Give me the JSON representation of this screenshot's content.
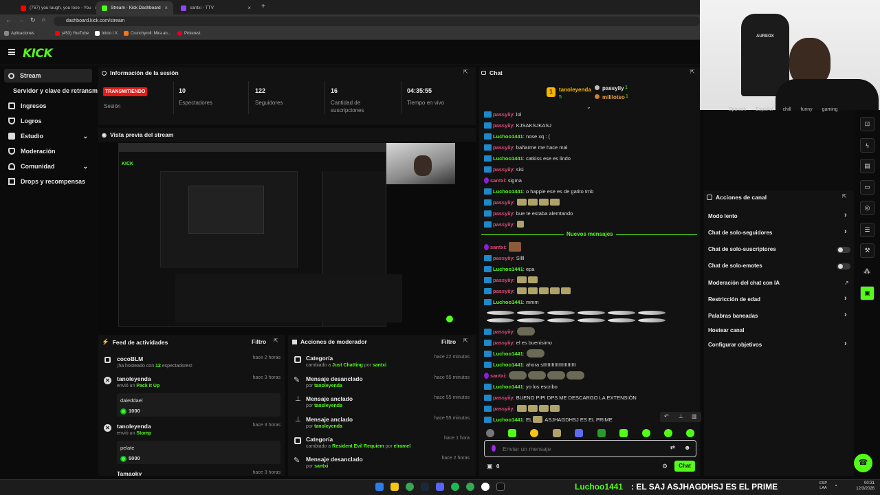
{
  "browser": {
    "tabs": [
      {
        "label": "(767) you laugh, you lose - You",
        "color": "#ff0000"
      },
      {
        "label": "Stream - Kick Dashboard",
        "color": "#53fc18"
      },
      {
        "label": "santxi - TTV",
        "color": "#9146ff"
      }
    ],
    "url": "dashboard.kick.com/stream",
    "bookmarks": [
      "Aplicaciones",
      "(453) YouTube",
      "Inicio / X",
      "Crunchyroll: Mira an...",
      "Pinterest"
    ]
  },
  "kick": {
    "logo": "KICK"
  },
  "sidebar": {
    "items": [
      {
        "label": "Stream",
        "icon": "broadcast-icon"
      },
      {
        "label": "Servidor y clave de retransm",
        "icon": ""
      },
      {
        "label": "Ingresos",
        "icon": "money-icon"
      },
      {
        "label": "Logros",
        "icon": "trophy-icon"
      },
      {
        "label": "Estudio",
        "icon": "studio-icon"
      },
      {
        "label": "Moderación",
        "icon": "shield-icon"
      },
      {
        "label": "Comunidad",
        "icon": "people-icon"
      },
      {
        "label": "Drops y recompensas",
        "icon": "gift-icon"
      }
    ]
  },
  "session": {
    "title": "Información de la sesión",
    "status": "TRANSMITIENDO",
    "status_label": "Sesión",
    "stats": [
      {
        "value": "10",
        "label": "Espectadores"
      },
      {
        "value": "122",
        "label": "Seguidores"
      },
      {
        "value": "16",
        "label": "Cantidad de suscripciones"
      },
      {
        "value": "04:35:55",
        "label": "Tiempo en vivo"
      }
    ]
  },
  "preview": {
    "title": "Vista previa del stream"
  },
  "activity": {
    "title": "Feed de actividades",
    "filter": "Filtro",
    "items": [
      {
        "user": "cocoBLM",
        "pre": "¡ha hosteado con ",
        "hl": "12",
        "post": " espectadores!",
        "time": "hace 2 horas"
      },
      {
        "user": "tanoleyenda",
        "pre": "envió un ",
        "hl": "Pack It Up",
        "post": "",
        "time": "hace 3 horas",
        "msg": "daleddael",
        "amount": "1000"
      },
      {
        "user": "tanoleyenda",
        "pre": "envió un ",
        "hl": "Stomp",
        "post": "",
        "time": "hace 3 horas",
        "msg": "pelate",
        "amount": "5000"
      },
      {
        "user": "Tamaoky",
        "pre": "",
        "hl": "",
        "post": "",
        "time": "hace 3 horas"
      }
    ]
  },
  "modactions": {
    "title": "Acciones de moderador",
    "filter": "Filtro",
    "items": [
      {
        "title": "Categoría",
        "pre": "cambiado a ",
        "hl": "Just Chatting",
        "mid": " por ",
        "by": "santxi",
        "time": "hace 22 minutos",
        "icon": "category-icon"
      },
      {
        "title": "Mensaje desanclado",
        "pre": "",
        "hl": "",
        "mid": "por ",
        "by": "tanoleyenda",
        "time": "hace 55 minutos",
        "icon": "unpin-icon"
      },
      {
        "title": "Mensaje anclado",
        "pre": "",
        "hl": "",
        "mid": "por ",
        "by": "tanoleyenda",
        "time": "hace 55 minutos",
        "icon": "pin-icon"
      },
      {
        "title": "Mensaje anclado",
        "pre": "",
        "hl": "",
        "mid": "por ",
        "by": "tanoleyenda",
        "time": "hace 55 minutos",
        "icon": "pin-icon"
      },
      {
        "title": "Categoría",
        "pre": "cambiado a ",
        "hl": "Resident Evil Requiem",
        "mid": " por ",
        "by": "elramel",
        "time": "hace 1 hora",
        "icon": "category-icon"
      },
      {
        "title": "Mensaje desanclado",
        "pre": "",
        "hl": "",
        "mid": "por ",
        "by": "santxi",
        "time": "hace 2 horas",
        "icon": "unpin-icon"
      }
    ]
  },
  "chat": {
    "title": "Chat",
    "leaders": {
      "first": "tanoleyenda",
      "first_count": "5",
      "second": "passyiiy",
      "second_count": "1",
      "third": "mililotso",
      "third_count": "1",
      "rank": "1"
    },
    "new_messages": "Nuevos mensajes",
    "lines": [
      {
        "user": "passyiiy",
        "color": "#e5497a",
        "text": "lol"
      },
      {
        "user": "passyiiy",
        "color": "#e5497a",
        "text": "KJSAKSJKASJ"
      },
      {
        "user": "Luchoo1441",
        "color": "#53fc18",
        "text": "nose xq : ("
      },
      {
        "user": "passyiiy",
        "color": "#e5497a",
        "text": "bañarme me hace mal"
      },
      {
        "user": "Luchoo1441",
        "color": "#53fc18",
        "text": "catkiss ese es lindo"
      },
      {
        "user": "passyiiy",
        "color": "#e5497a",
        "text": "sisi"
      },
      {
        "user": "santxi",
        "color": "#e5497a",
        "text": "sigma"
      },
      {
        "user": "Luchoo1441",
        "color": "#53fc18",
        "text": "o happie ese es de gatito tmb"
      },
      {
        "user": "passyiiy",
        "color": "#e5497a",
        "text": ""
      },
      {
        "user": "passyiiy",
        "color": "#e5497a",
        "text": "bue te estaba alemtando"
      },
      {
        "user": "passyiiy",
        "color": "#e5497a",
        "text": ""
      },
      {
        "user": "santxi",
        "color": "#e5497a",
        "text": ""
      },
      {
        "user": "passyiiy",
        "color": "#e5497a",
        "text": "Sllll"
      },
      {
        "user": "Luchoo1441",
        "color": "#53fc18",
        "text": "epa"
      },
      {
        "user": "passyiiy",
        "color": "#e5497a",
        "text": ""
      },
      {
        "user": "passyiiy",
        "color": "#e5497a",
        "text": ""
      },
      {
        "user": "Luchoo1441",
        "color": "#53fc18",
        "text": "mmm"
      },
      {
        "user": "passyiiy",
        "color": "#e5497a",
        "text": ""
      },
      {
        "user": "passyiiy",
        "color": "#e5497a",
        "text": "el"
      },
      {
        "user": "Luchoo1441",
        "color": "#53fc18",
        "text": ""
      },
      {
        "user": "Luchoo1441",
        "color": "#53fc18",
        "text": "ahora sIIIIIIIIIIIIIIIIIIIIIII"
      },
      {
        "user": "santxi",
        "color": "#e5497a",
        "text": ""
      },
      {
        "user": "Luchoo1441",
        "color": "#53fc18",
        "text": "yo los escribo"
      },
      {
        "user": "passyiiy",
        "color": "#e5497a",
        "text": "BUENO PIPI DPS ME DESCARGO LA EXTENSIÓN"
      },
      {
        "user": "passyiiy",
        "color": "#e5497a",
        "text": ""
      },
      {
        "user": "Luchoo1441",
        "color": "#53fc18",
        "text": "EL"
      }
    ],
    "es_buenisimo": "es buenisimo",
    "last_tail": "ASJHAGDHSJ ES EL PRIME",
    "input_placeholder": "Enviar un mensaje",
    "count": "0",
    "send": "Chat"
  },
  "stream_tags": [
    "Spanish",
    "Español",
    "chill",
    "funny",
    "gaming"
  ],
  "channel_actions": {
    "title": "Acciones de canal",
    "items": [
      {
        "label": "Modo lento",
        "kind": "chevron"
      },
      {
        "label": "Chat de solo-seguidores",
        "kind": "chevron"
      },
      {
        "label": "Chat de solo-suscriptores",
        "kind": "toggle"
      },
      {
        "label": "Chat de solo-emotes",
        "kind": "toggle"
      },
      {
        "label": "Moderación del chat con IA",
        "kind": "link"
      },
      {
        "label": "Restricción de edad",
        "kind": "chevron"
      },
      {
        "label": "Palabras baneadas",
        "kind": "chevron"
      },
      {
        "label": "Hostear canal",
        "kind": "none"
      },
      {
        "label": "Configurar objetivos",
        "kind": "chevron"
      }
    ]
  },
  "overlay": {
    "user": "Luchoo1441",
    "text": ": EL SAJ ASJHAGDHSJ ES EL PRIME"
  },
  "taskbar": {
    "lang": "ESP",
    "lang2": "LAA",
    "time": "00:31",
    "date": "12/3/2026"
  },
  "colors": {
    "brand": "#53fc18",
    "live": "#e91916"
  }
}
